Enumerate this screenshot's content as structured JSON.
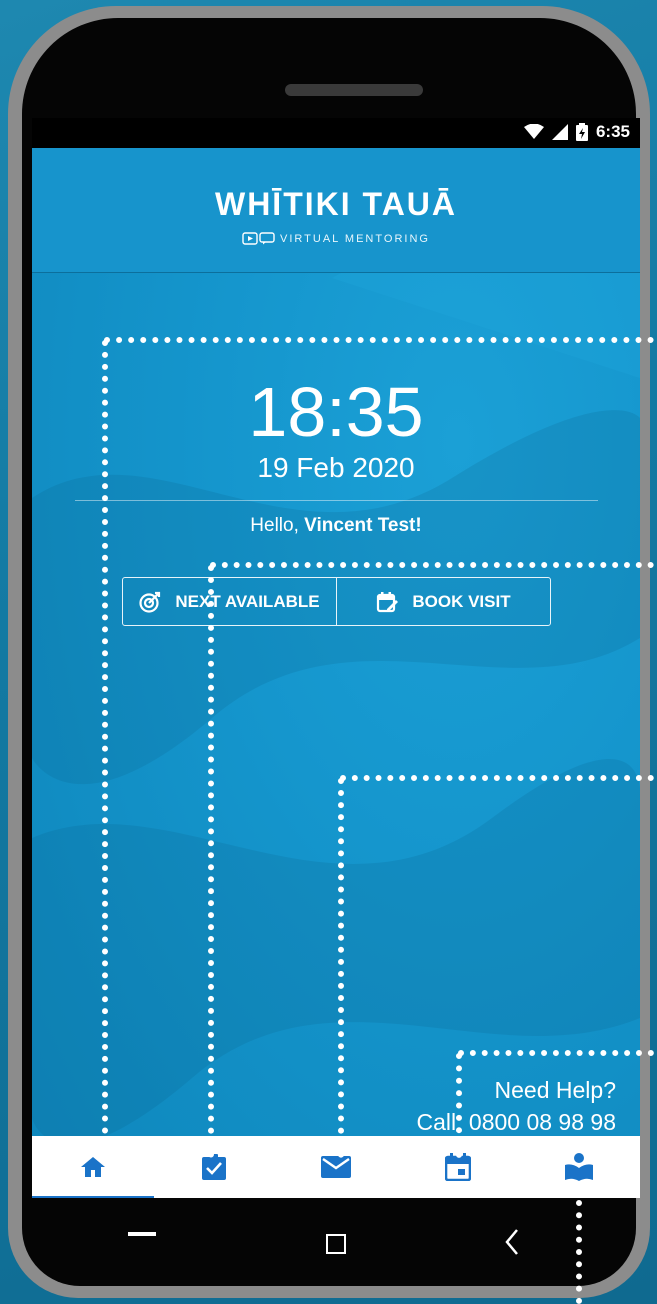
{
  "status_bar": {
    "time": "6:35"
  },
  "header": {
    "brand": "WHĪTIKI TAUĀ",
    "subtitle": "VIRTUAL MENTORING"
  },
  "main": {
    "clock": "18:35",
    "date": "19 Feb 2020",
    "greeting_prefix": "Hello,",
    "user_name": "Vincent Test!",
    "buttons": [
      {
        "label": "NEXT AVAILABLE",
        "icon": "target-icon"
      },
      {
        "label": "BOOK VISIT",
        "icon": "calendar-edit-icon"
      }
    ],
    "help": {
      "title": "Need Help?",
      "phone": "Call: 0800 08 98 98"
    }
  },
  "bottom_nav": [
    {
      "name": "home",
      "icon": "home-icon",
      "active": true
    },
    {
      "name": "tasks",
      "icon": "clipboard-check-icon",
      "active": false
    },
    {
      "name": "messages",
      "icon": "mail-icon",
      "active": false
    },
    {
      "name": "calendar",
      "icon": "calendar-icon",
      "active": false
    },
    {
      "name": "resources",
      "icon": "book-reader-icon",
      "active": false
    }
  ],
  "colors": {
    "accent": "#1a73c8",
    "header": "#1794cc",
    "background": "#1596cd"
  }
}
